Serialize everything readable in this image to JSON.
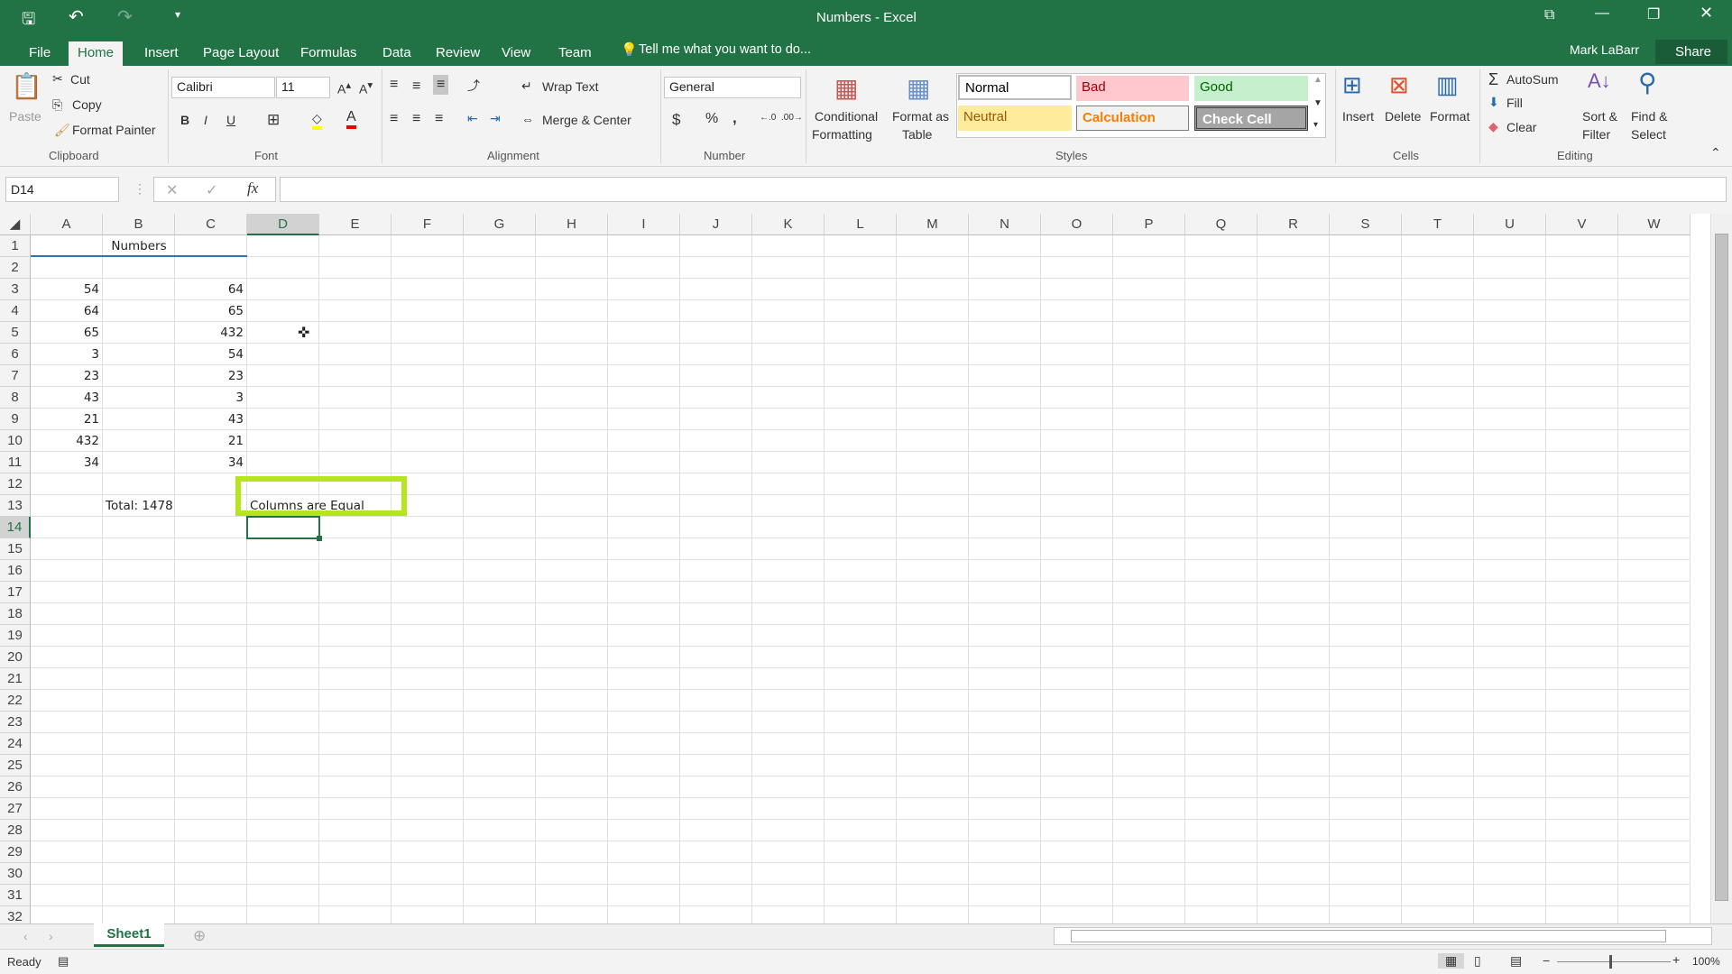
{
  "title": "Numbers - Excel",
  "user": "Mark LaBarr",
  "share": "Share",
  "tabs": [
    "File",
    "Home",
    "Insert",
    "Page Layout",
    "Formulas",
    "Data",
    "Review",
    "View",
    "Team"
  ],
  "tell_me": "Tell me what you want to do...",
  "clipboard": {
    "paste": "Paste",
    "cut": "Cut",
    "copy": "Copy",
    "format_painter": "Format Painter",
    "label": "Clipboard"
  },
  "font": {
    "name": "Calibri",
    "size": "11",
    "label": "Font",
    "bold": "B",
    "italic": "I",
    "underline": "U"
  },
  "alignment": {
    "wrap": "Wrap Text",
    "merge": "Merge & Center",
    "label": "Alignment"
  },
  "number": {
    "format": "General",
    "label": "Number",
    "currency": "$",
    "percent": "%",
    "comma": ","
  },
  "styles": {
    "cond1": "Conditional",
    "cond2": "Formatting",
    "fat1": "Format as",
    "fat2": "Table",
    "normal": "Normal",
    "bad": "Bad",
    "good": "Good",
    "neutral": "Neutral",
    "calculation": "Calculation",
    "check": "Check Cell",
    "label": "Styles"
  },
  "cells_group": {
    "insert": "Insert",
    "delete": "Delete",
    "format": "Format",
    "label": "Cells"
  },
  "editing": {
    "autosum": "AutoSum",
    "fill": "Fill",
    "clear": "Clear",
    "sort1": "Sort &",
    "sort2": "Filter",
    "find1": "Find &",
    "find2": "Select",
    "label": "Editing"
  },
  "name_box": "D14",
  "formula": "",
  "columns": [
    "A",
    "B",
    "C",
    "D",
    "E",
    "F",
    "G",
    "H",
    "I",
    "J",
    "K",
    "L",
    "M",
    "N",
    "O",
    "P",
    "Q",
    "R",
    "S",
    "T",
    "U",
    "V",
    "W"
  ],
  "selected_cell": "D14",
  "cells": [
    {
      "ref": "B1",
      "value": "Numbers",
      "align": "center"
    },
    {
      "ref": "A3",
      "value": "54",
      "align": "right"
    },
    {
      "ref": "C3",
      "value": "64",
      "align": "right"
    },
    {
      "ref": "A4",
      "value": "64",
      "align": "right"
    },
    {
      "ref": "C4",
      "value": "65",
      "align": "right"
    },
    {
      "ref": "A5",
      "value": "65",
      "align": "right"
    },
    {
      "ref": "C5",
      "value": "432",
      "align": "right"
    },
    {
      "ref": "A6",
      "value": "3",
      "align": "right"
    },
    {
      "ref": "C6",
      "value": "54",
      "align": "right"
    },
    {
      "ref": "A7",
      "value": "23",
      "align": "right"
    },
    {
      "ref": "C7",
      "value": "23",
      "align": "right"
    },
    {
      "ref": "A8",
      "value": "43",
      "align": "right"
    },
    {
      "ref": "C8",
      "value": "3",
      "align": "right"
    },
    {
      "ref": "A9",
      "value": "21",
      "align": "right"
    },
    {
      "ref": "C9",
      "value": "43",
      "align": "right"
    },
    {
      "ref": "A10",
      "value": "432",
      "align": "right"
    },
    {
      "ref": "C10",
      "value": "21",
      "align": "right"
    },
    {
      "ref": "A11",
      "value": "34",
      "align": "right"
    },
    {
      "ref": "C11",
      "value": "34",
      "align": "right"
    },
    {
      "ref": "B13",
      "value": "Total: 1478",
      "align": "left"
    },
    {
      "ref": "D13",
      "value": "Columns are Equal",
      "align": "left"
    }
  ],
  "highlight_color": "#b5e61d",
  "sheet_tab": "Sheet1",
  "status": "Ready",
  "zoom": "100%"
}
